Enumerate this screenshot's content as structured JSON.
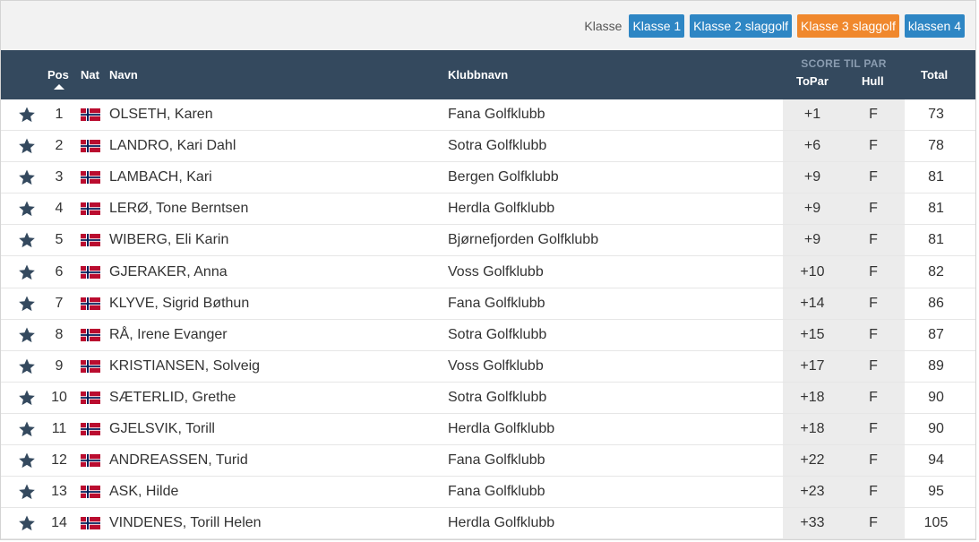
{
  "filter": {
    "label": "Klasse",
    "buttons": [
      {
        "label": "Klasse 1",
        "state": "default"
      },
      {
        "label": "Klasse 2 slaggolf",
        "state": "default"
      },
      {
        "label": "Klasse 3 slaggolf",
        "state": "active"
      },
      {
        "label": "klassen 4",
        "state": "default"
      }
    ]
  },
  "colors": {
    "header_bg": "#34495e",
    "button_blue": "#2e86c4",
    "button_active": "#f0882d",
    "score_col_bg": "#ececec"
  },
  "table": {
    "headers": {
      "pos": "Pos",
      "nat": "Nat",
      "name": "Navn",
      "club": "Klubbnavn",
      "score_group": "SCORE TIL PAR",
      "topar": "ToPar",
      "hull": "Hull",
      "total": "Total"
    },
    "sort": {
      "column": "pos",
      "direction": "ascending"
    },
    "rows": [
      {
        "pos": "1",
        "nat": "norway-flag-icon",
        "name": "OLSETH, Karen",
        "club": "Fana Golfklubb",
        "topar": "+1",
        "hull": "F",
        "total": "73"
      },
      {
        "pos": "2",
        "nat": "norway-flag-icon",
        "name": "LANDRO, Kari Dahl",
        "club": "Sotra Golfklubb",
        "topar": "+6",
        "hull": "F",
        "total": "78"
      },
      {
        "pos": "3",
        "nat": "norway-flag-icon",
        "name": "LAMBACH, Kari",
        "club": "Bergen Golfklubb",
        "topar": "+9",
        "hull": "F",
        "total": "81"
      },
      {
        "pos": "4",
        "nat": "norway-flag-icon",
        "name": "LERØ, Tone Berntsen",
        "club": "Herdla Golfklubb",
        "topar": "+9",
        "hull": "F",
        "total": "81"
      },
      {
        "pos": "5",
        "nat": "norway-flag-icon",
        "name": "WIBERG, Eli Karin",
        "club": "Bjørnefjorden Golfklubb",
        "topar": "+9",
        "hull": "F",
        "total": "81"
      },
      {
        "pos": "6",
        "nat": "norway-flag-icon",
        "name": "GJERAKER, Anna",
        "club": "Voss Golfklubb",
        "topar": "+10",
        "hull": "F",
        "total": "82"
      },
      {
        "pos": "7",
        "nat": "norway-flag-icon",
        "name": "KLYVE, Sigrid Bøthun",
        "club": "Fana Golfklubb",
        "topar": "+14",
        "hull": "F",
        "total": "86"
      },
      {
        "pos": "8",
        "nat": "norway-flag-icon",
        "name": "RÅ, Irene Evanger",
        "club": "Sotra Golfklubb",
        "topar": "+15",
        "hull": "F",
        "total": "87"
      },
      {
        "pos": "9",
        "nat": "norway-flag-icon",
        "name": "KRISTIANSEN, Solveig",
        "club": "Voss Golfklubb",
        "topar": "+17",
        "hull": "F",
        "total": "89"
      },
      {
        "pos": "10",
        "nat": "norway-flag-icon",
        "name": "SÆTERLID, Grethe",
        "club": "Sotra Golfklubb",
        "topar": "+18",
        "hull": "F",
        "total": "90"
      },
      {
        "pos": "11",
        "nat": "norway-flag-icon",
        "name": "GJELSVIK, Torill",
        "club": "Herdla Golfklubb",
        "topar": "+18",
        "hull": "F",
        "total": "90"
      },
      {
        "pos": "12",
        "nat": "norway-flag-icon",
        "name": "ANDREASSEN, Turid",
        "club": "Fana Golfklubb",
        "topar": "+22",
        "hull": "F",
        "total": "94"
      },
      {
        "pos": "13",
        "nat": "norway-flag-icon",
        "name": "ASK, Hilde",
        "club": "Fana Golfklubb",
        "topar": "+23",
        "hull": "F",
        "total": "95"
      },
      {
        "pos": "14",
        "nat": "norway-flag-icon",
        "name": "VINDENES, Torill Helen",
        "club": "Herdla Golfklubb",
        "topar": "+33",
        "hull": "F",
        "total": "105"
      }
    ]
  }
}
